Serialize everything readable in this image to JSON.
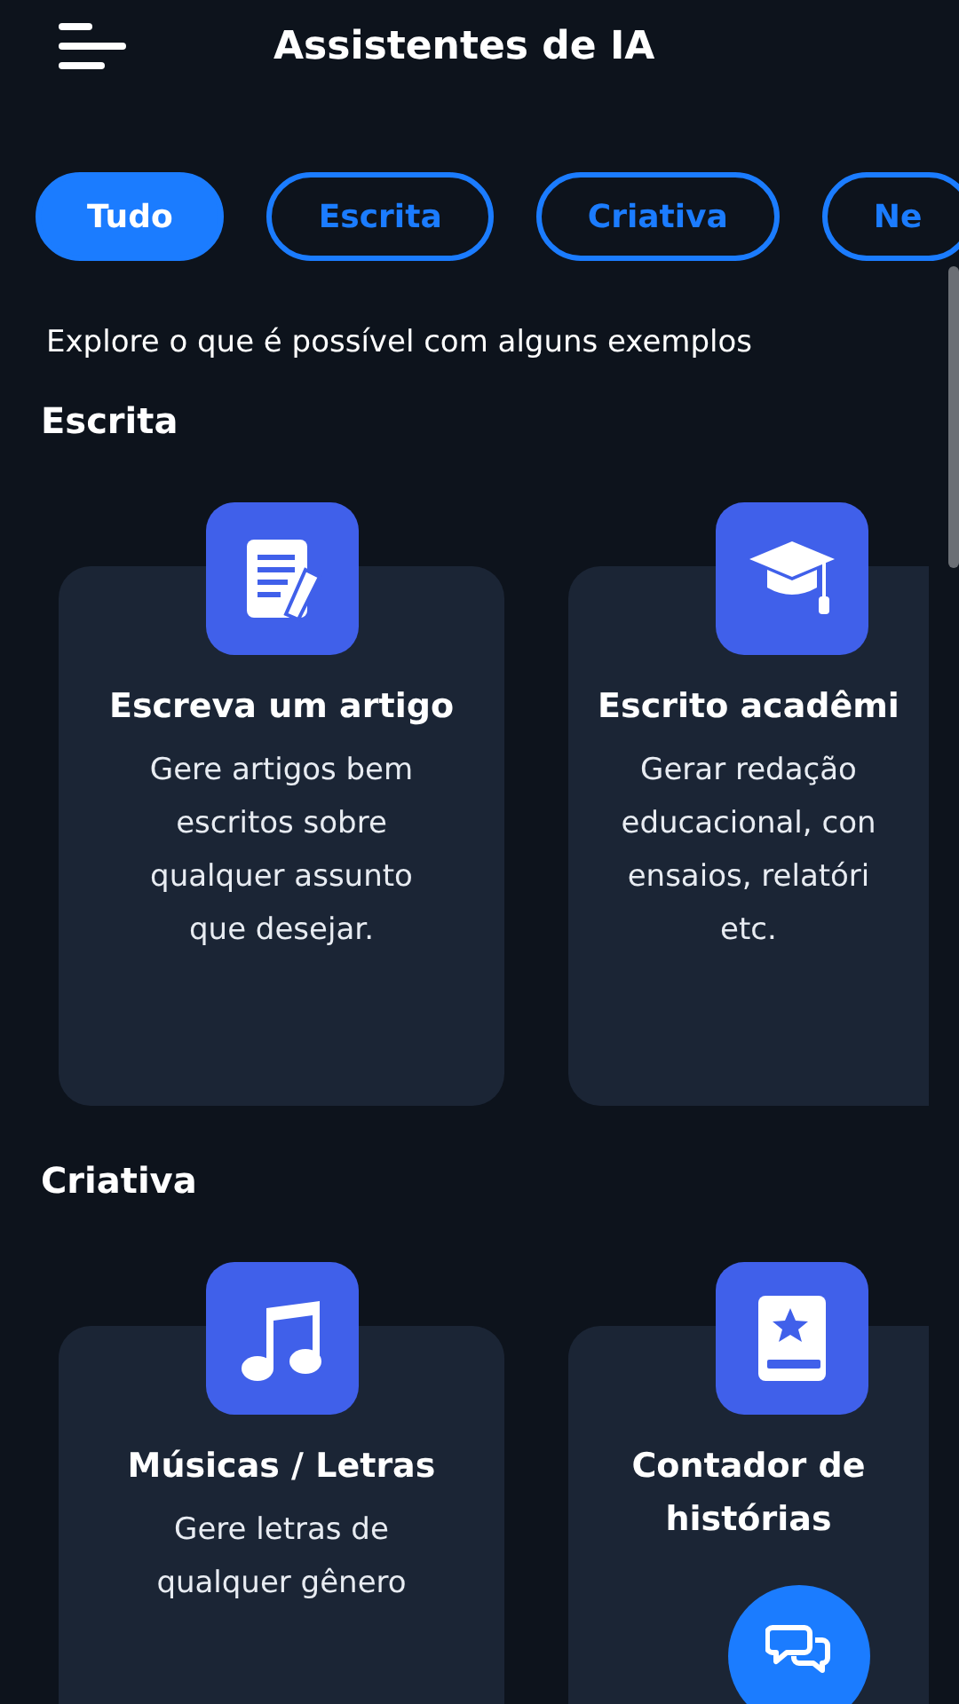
{
  "header": {
    "title": "Assistentes de IA"
  },
  "tabs": [
    {
      "label": "Tudo",
      "selected": true
    },
    {
      "label": "Escrita",
      "selected": false
    },
    {
      "label": "Criativa",
      "selected": false
    },
    {
      "label": "Ne",
      "selected": false
    }
  ],
  "intro": "Explore o que é possível com alguns exemplos",
  "sections": [
    {
      "heading": "Escrita",
      "cards": [
        {
          "kind": "document",
          "title": "Escreva um artigo",
          "description": "Gere artigos bem\nescritos sobre\nqualquer assunto\nque desejar."
        },
        {
          "kind": "graduation",
          "title": "Escrito acadêmi",
          "description": "Gerar redação\neducacional, con\nensaios, relatóri\netc."
        }
      ]
    },
    {
      "heading": "Criativa",
      "cards": [
        {
          "kind": "music",
          "title": "Músicas / Letras",
          "description": "Gere letras de\nqualquer gênero"
        },
        {
          "kind": "book",
          "title": "Contador de\nhistórias"
        }
      ]
    }
  ]
}
